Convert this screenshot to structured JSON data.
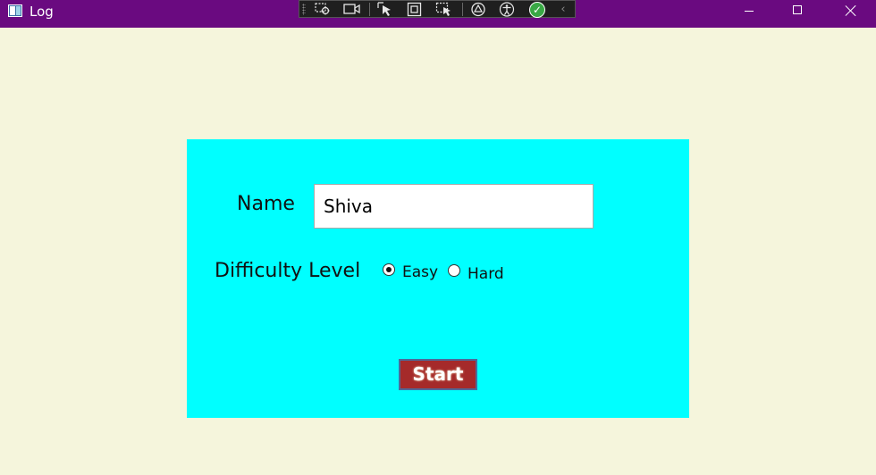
{
  "window": {
    "title": "Log",
    "background_color": "#f5f5dc",
    "titlebar_color": "#6a0a80"
  },
  "debug_toolbar": {
    "icons": [
      "select-element-icon",
      "video-icon",
      "cursor-icon",
      "highlight-box-icon",
      "track-focus-icon",
      "hot-reload-icon",
      "accessibility-icon",
      "check-icon",
      "collapse-icon"
    ]
  },
  "form": {
    "panel_color": "#00ffff",
    "name_label": "Name",
    "name_value": "Shiva",
    "difficulty_label": "Difficulty Level",
    "options": [
      {
        "label": "Easy",
        "checked": true
      },
      {
        "label": "Hard",
        "checked": false
      }
    ],
    "start_label": "Start",
    "start_color": "#a52a2a"
  }
}
